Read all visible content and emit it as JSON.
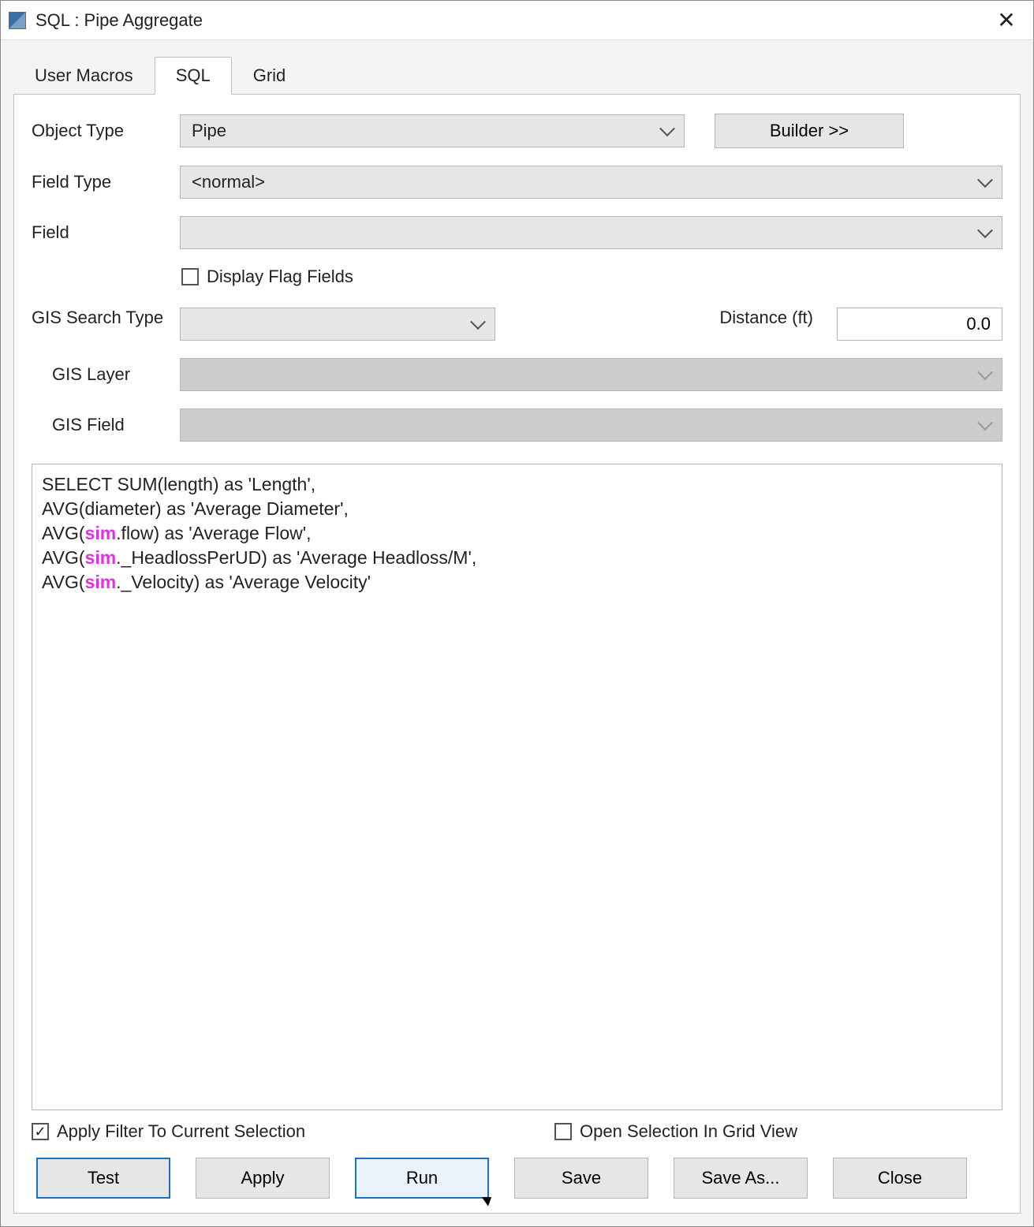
{
  "window": {
    "title": "SQL : Pipe Aggregate"
  },
  "tabs": {
    "user_macros": "User Macros",
    "sql": "SQL",
    "grid": "Grid",
    "active": "sql"
  },
  "form": {
    "object_type": {
      "label": "Object Type",
      "value": "Pipe"
    },
    "builder_btn": "Builder >>",
    "field_type": {
      "label": "Field Type",
      "value": "<normal>"
    },
    "field": {
      "label": "Field",
      "value": ""
    },
    "display_flag_fields": {
      "label": "Display Flag Fields",
      "checked": false
    },
    "gis_search_type": {
      "label": "GIS Search Type",
      "value": ""
    },
    "distance": {
      "label": "Distance (ft)",
      "value": "0.0"
    },
    "gis_layer": {
      "label": "GIS Layer",
      "value": ""
    },
    "gis_field": {
      "label": "GIS Field",
      "value": ""
    }
  },
  "sql": {
    "tokens": [
      {
        "t": "SELECT SUM(length) as 'Length',\n"
      },
      {
        "t": "AVG(diameter) as 'Average Diameter',\n"
      },
      {
        "t": "AVG("
      },
      {
        "t": "sim",
        "c": "sim"
      },
      {
        "t": ".flow) as 'Average Flow',\n"
      },
      {
        "t": "AVG("
      },
      {
        "t": "sim",
        "c": "sim"
      },
      {
        "t": "._HeadlossPerUD) as 'Average Headloss/M',\n"
      },
      {
        "t": "AVG("
      },
      {
        "t": "sim",
        "c": "sim"
      },
      {
        "t": "._Velocity) as 'Average Velocity'"
      }
    ]
  },
  "footer": {
    "apply_filter": {
      "label": "Apply Filter To Current Selection",
      "checked": true
    },
    "open_grid": {
      "label": "Open Selection In Grid View",
      "checked": false
    }
  },
  "buttons": {
    "test": "Test",
    "apply": "Apply",
    "run": "Run",
    "save": "Save",
    "save_as": "Save As...",
    "close": "Close"
  }
}
